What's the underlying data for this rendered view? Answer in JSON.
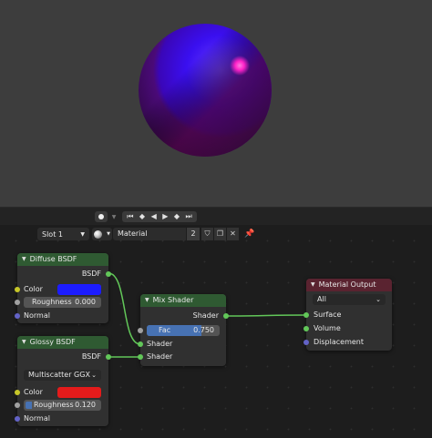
{
  "colors": {
    "viewport_bg": "#3d3d3d",
    "editor_bg": "#1d1d1d",
    "shader_header": "#2f5a32",
    "output_header": "#5a2330",
    "link": "#62c759",
    "diffuse_color": "#1c1cff",
    "glossy_color": "#e41b1b",
    "fac_bar": "#4772b3"
  },
  "header": {
    "slot_label": "Slot 1",
    "material_name": "Material",
    "user_count": "2",
    "icons": [
      "chevron-down-icon",
      "material-sphere-icon",
      "shield-icon",
      "duplicate-icon",
      "close-icon",
      "pin-icon"
    ]
  },
  "nodes": {
    "diffuse": {
      "title": "Diffuse BSDF",
      "out": "BSDF",
      "color_label": "Color",
      "roughness_label": "Roughness",
      "roughness_value": "0.000",
      "normal_label": "Normal"
    },
    "glossy": {
      "title": "Glossy BSDF",
      "out": "BSDF",
      "distribution": "Multiscatter GGX",
      "color_label": "Color",
      "roughness_label": "Roughness",
      "roughness_value": "0.120",
      "normal_label": "Normal"
    },
    "mix": {
      "title": "Mix Shader",
      "out": "Shader",
      "fac_label": "Fac",
      "fac_value": "0.750",
      "fac_fraction": 0.75,
      "in1": "Shader",
      "in2": "Shader"
    },
    "output": {
      "title": "Material Output",
      "target": "All",
      "surface": "Surface",
      "volume": "Volume",
      "displacement": "Displacement"
    }
  }
}
